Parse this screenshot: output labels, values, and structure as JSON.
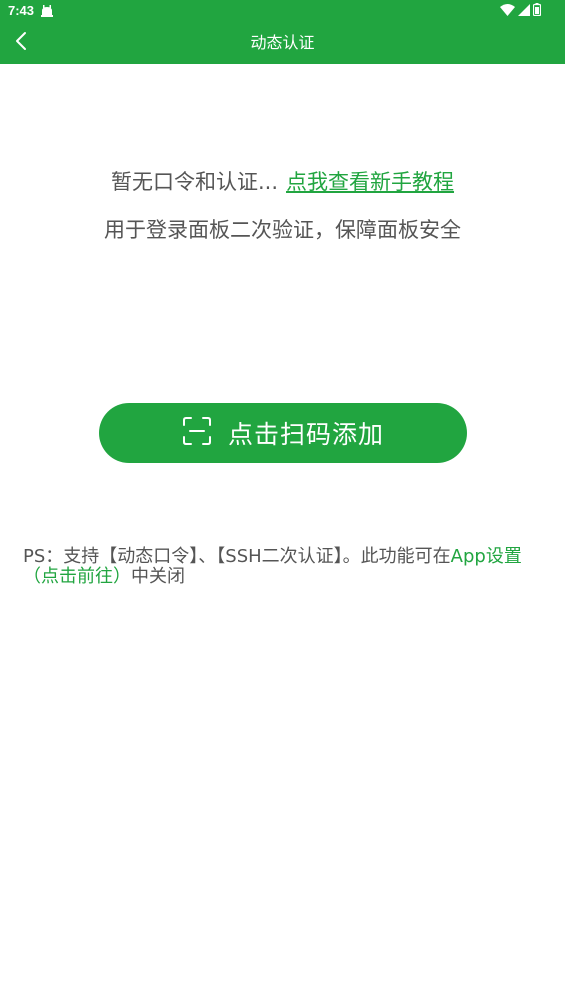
{
  "status_bar": {
    "time": "7:43",
    "icons": [
      "notification-icon",
      "wifi-icon",
      "signal-icon",
      "battery-icon"
    ],
    "background": "#21a540"
  },
  "app_bar": {
    "title": "动态认证",
    "back_icon": "chevron-left-icon",
    "background": "#21a540"
  },
  "empty_state": {
    "message": "暂无口令和认证...",
    "tutorial_link": "点我查看新手教程",
    "description": "用于登录面板二次验证，保障面板安全"
  },
  "scan_button": {
    "icon": "scan-icon",
    "label": "点击扫码添加"
  },
  "note": {
    "prefix": "PS：支持【动态口令】、【SSH二次认证】。此功能可在",
    "link": "App设置（点击前往）",
    "suffix": "中关闭"
  },
  "colors": {
    "accent": "#21a540",
    "text_secondary": "#555555",
    "background": "#ffffff"
  }
}
